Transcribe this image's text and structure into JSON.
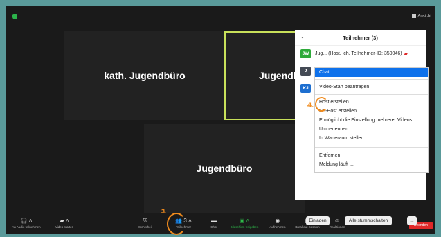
{
  "top": {
    "view_label": "Ansicht"
  },
  "tiles": [
    "kath. Jugendbüro",
    "Jugendb",
    "Jugendbüro"
  ],
  "panel": {
    "title": "Teilnehmer (3)",
    "participants": [
      {
        "initials": "JW",
        "name": "Jug... (Host, ich, Teilnehmer-ID: 350046)",
        "color": "#2eaa3a"
      },
      {
        "initials": "J",
        "name": "",
        "color": "#444a55"
      },
      {
        "initials": "KJ",
        "name": "",
        "color": "#1e6fd0"
      }
    ],
    "buttons": {
      "invite": "Einladen",
      "mute_all": "Alle stummschalten",
      "more": "..."
    }
  },
  "context_menu": {
    "items": [
      "Chat",
      "Video-Start beantragen",
      "Host erstellen",
      "Co-Host erstellen",
      "Ermöglicht die Einstellung mehrerer Videos",
      "Umbenennen",
      "In Warteraum stellen",
      "Entfernen",
      "Meldung läuft ..."
    ]
  },
  "annotations": {
    "step3": "3.",
    "step4": "4."
  },
  "toolbar": {
    "audio": "An Audio teilnehmen",
    "video": "Video starten",
    "security": "Sicherheit",
    "participants": "Teilnehmer",
    "participants_count": "3",
    "chat": "Chat",
    "share": "Bildschirm freigeben",
    "record": "Aufnehmen",
    "breakout": "Breakout Session",
    "reactions": "Reaktionen",
    "end": "Beenden"
  },
  "colors": {
    "accent": "#0e71eb",
    "annotation": "#f08b1d",
    "active_speaker": "#c8e05a",
    "end": "#e02828"
  }
}
